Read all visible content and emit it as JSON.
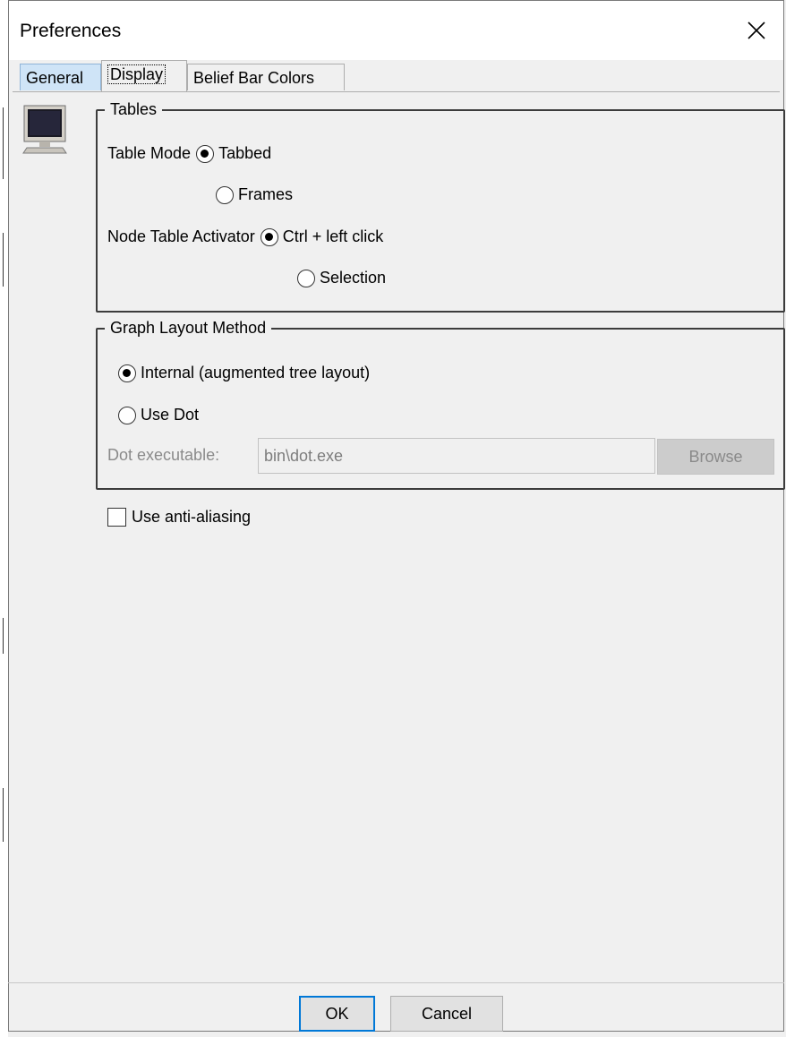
{
  "window": {
    "title": "Preferences"
  },
  "tabs": [
    {
      "label": "General",
      "active": false
    },
    {
      "label": "Display",
      "active": true
    },
    {
      "label": "Belief Bar Colors",
      "active": false
    }
  ],
  "tables_group": {
    "legend": "Tables",
    "table_mode_label": "Table Mode",
    "table_mode_options": [
      {
        "label": "Tabbed",
        "checked": true
      },
      {
        "label": "Frames",
        "checked": false
      }
    ],
    "node_table_activator_label": "Node Table Activator",
    "node_table_activator_options": [
      {
        "label": "Ctrl + left click",
        "checked": true
      },
      {
        "label": "Selection",
        "checked": false
      }
    ]
  },
  "graph_group": {
    "legend": "Graph Layout Method",
    "options": [
      {
        "label": "Internal (augmented tree layout)",
        "checked": true
      },
      {
        "label": "Use Dot",
        "checked": false
      }
    ],
    "dot_executable_label": "Dot executable:",
    "dot_executable_value": "bin\\dot.exe",
    "browse_label": "Browse"
  },
  "anti_aliasing": {
    "label": "Use anti-aliasing",
    "checked": false
  },
  "footer": {
    "ok_label": "OK",
    "cancel_label": "Cancel"
  },
  "colors": {
    "active_tab_highlight": "#cfe4f7",
    "default_button_border": "#0078d7",
    "group_border": "#3c3c3c"
  },
  "icons": {
    "monitor": "monitor-icon",
    "close": "close-icon"
  }
}
